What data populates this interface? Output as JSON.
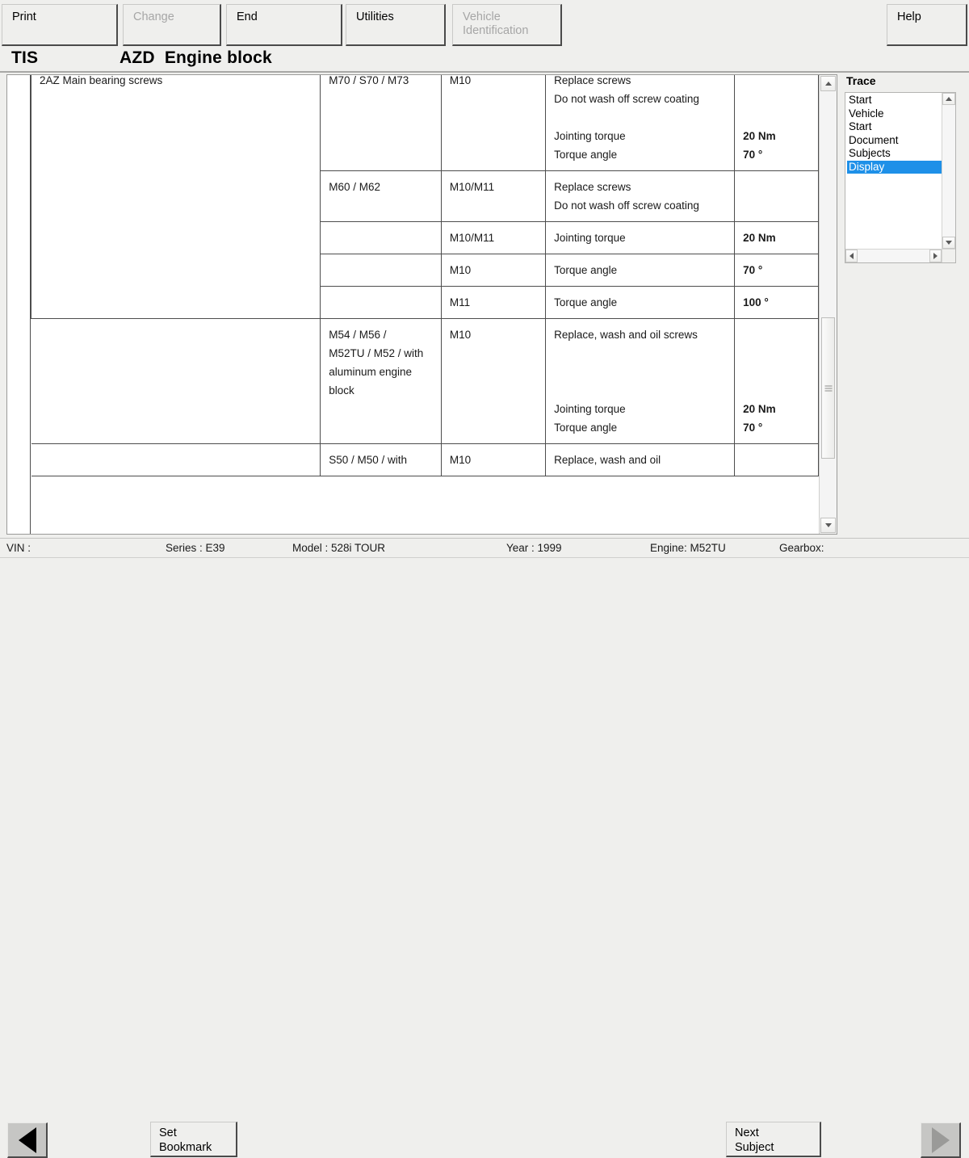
{
  "toolbar": {
    "print": "Print",
    "change": "Change",
    "end": "End",
    "utilities": "Utilities",
    "vehicle_identification": "Vehicle\nIdentification",
    "help": "Help"
  },
  "title": {
    "system": "TIS",
    "document": "AZD  Engine block"
  },
  "document": {
    "section_label": "2AZ  Main bearing screws",
    "rows": [
      {
        "engine": "M70 / S70 / M73",
        "size": "M10",
        "notes": [
          "Replace screws",
          "Do not wash off screw coating",
          "",
          "Jointing torque",
          "Torque angle"
        ],
        "values": [
          "",
          "",
          "",
          "20 Nm",
          "70 °"
        ]
      },
      {
        "engine": "M60 / M62",
        "size": "M10/M11",
        "notes": [
          "Replace screws",
          "Do not wash off screw coating"
        ],
        "values": []
      },
      {
        "engine": "",
        "size": "M10/M11",
        "notes": [
          "Jointing torque"
        ],
        "values": [
          "20 Nm"
        ]
      },
      {
        "engine": "",
        "size": "M10",
        "notes": [
          "Torque angle"
        ],
        "values": [
          "70 °"
        ]
      },
      {
        "engine": "",
        "size": "M11",
        "notes": [
          "Torque angle"
        ],
        "values": [
          "100 °"
        ]
      },
      {
        "engine": "M54 / M56 /\nM52TU / M52 / with\naluminum engine\nblock",
        "size": "M10",
        "notes": [
          "Replace, wash and oil screws",
          "",
          "",
          "",
          "Jointing torque",
          "Torque angle"
        ],
        "values": [
          "",
          "",
          "",
          "",
          "20 Nm",
          "70 °"
        ]
      }
    ],
    "clipped_row": {
      "engine": "S50 / M50 / with",
      "size": "M10",
      "notes": [
        "Replace, wash and oil"
      ],
      "values": [
        ""
      ]
    }
  },
  "trace": {
    "title": "Trace",
    "items": [
      {
        "label": "Start",
        "selected": false
      },
      {
        "label": "Vehicle",
        "selected": false
      },
      {
        "label": "Start",
        "selected": false
      },
      {
        "label": "Document",
        "selected": false
      },
      {
        "label": "Subjects",
        "selected": false
      },
      {
        "label": "Display",
        "selected": true
      }
    ],
    "highlight_color": "#1e90e8"
  },
  "status": {
    "vin": "VIN :",
    "series": "Series : E39",
    "model": "Model : 528i TOUR",
    "year": "Year : 1999",
    "engine": "Engine: M52TU",
    "gearbox": "Gearbox:"
  },
  "nav": {
    "previous": "◀",
    "set_bookmark": "Set\nBookmark",
    "next_subject": "Next\nSubject",
    "next": "▶"
  }
}
